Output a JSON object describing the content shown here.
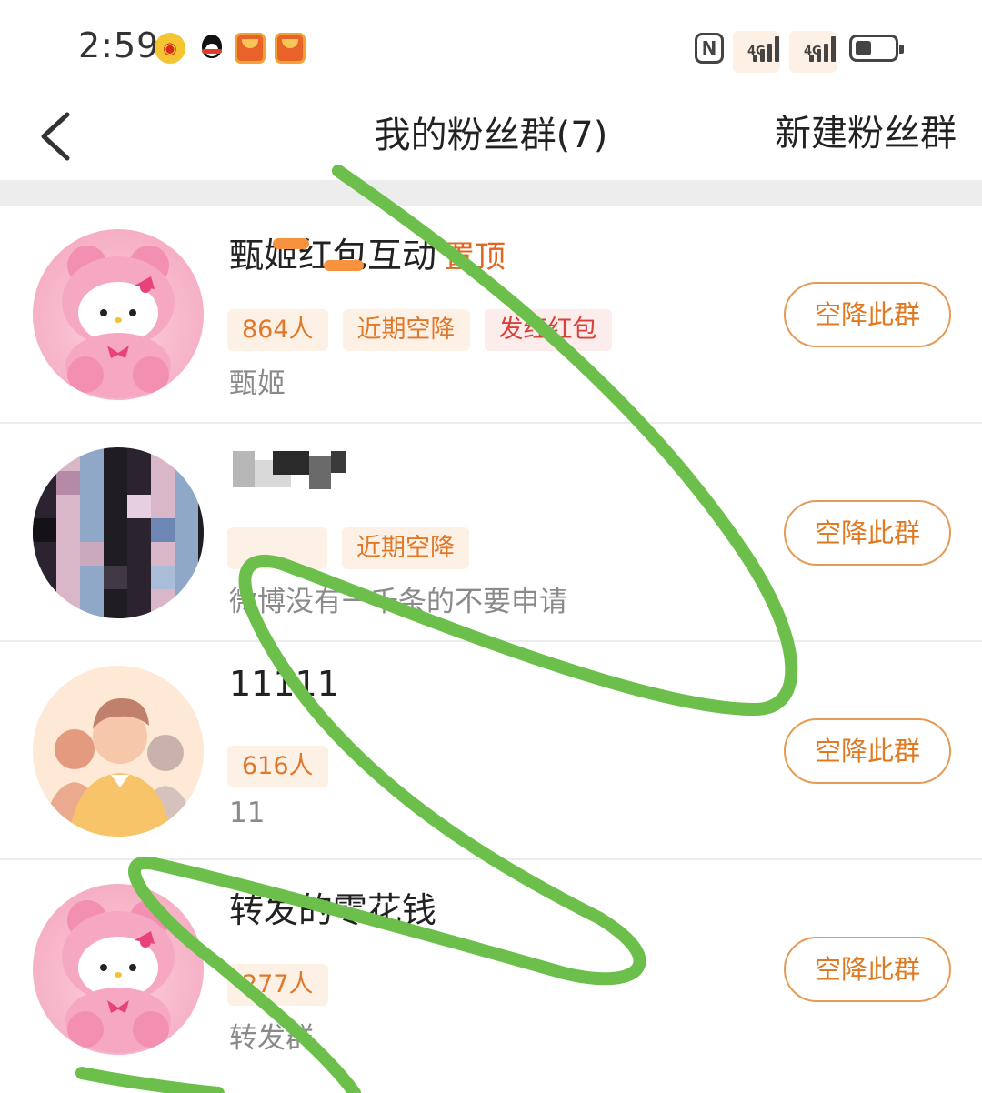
{
  "status_bar": {
    "time": "2:59",
    "notification_icons": [
      "weibo-icon",
      "qq-icon",
      "red-envelope-icon",
      "red-envelope-icon"
    ],
    "system_icons": [
      "nfc-icon",
      "signal-4g-icon",
      "signal-4g-icon",
      "battery-icon"
    ],
    "network_label_1": "4G",
    "network_label_2": "4G",
    "battery_level": 0.4
  },
  "header": {
    "back_icon": "chevron-left-icon",
    "title": "我的粉丝群(7)",
    "create_label": "新建粉丝群"
  },
  "groups": [
    {
      "name": "甄姬红包互动",
      "pin_label": "置顶",
      "tags": [
        "864人",
        "近期空降",
        "发红红包"
      ],
      "description": "甄姬",
      "avatar": "hello-kitty-avatar",
      "button_label": "空降此群"
    },
    {
      "name": "",
      "tags": [
        "",
        "近期空降"
      ],
      "description": "微博没有一千条的不要申请",
      "avatar": "blurred-avatar",
      "button_label": "空降此群"
    },
    {
      "name": "11111",
      "tags": [
        "616人"
      ],
      "description": "11",
      "avatar": "default-group-avatar",
      "button_label": "空降此群"
    },
    {
      "name": "转发的零花钱",
      "tags": [
        "277人"
      ],
      "description": "转发群",
      "avatar": "hello-kitty-avatar",
      "button_label": "空降此群"
    }
  ],
  "colors": {
    "accent": "#e07a22",
    "tag_bg": "#fdf1e6",
    "scribble": "#6cbf4a"
  }
}
